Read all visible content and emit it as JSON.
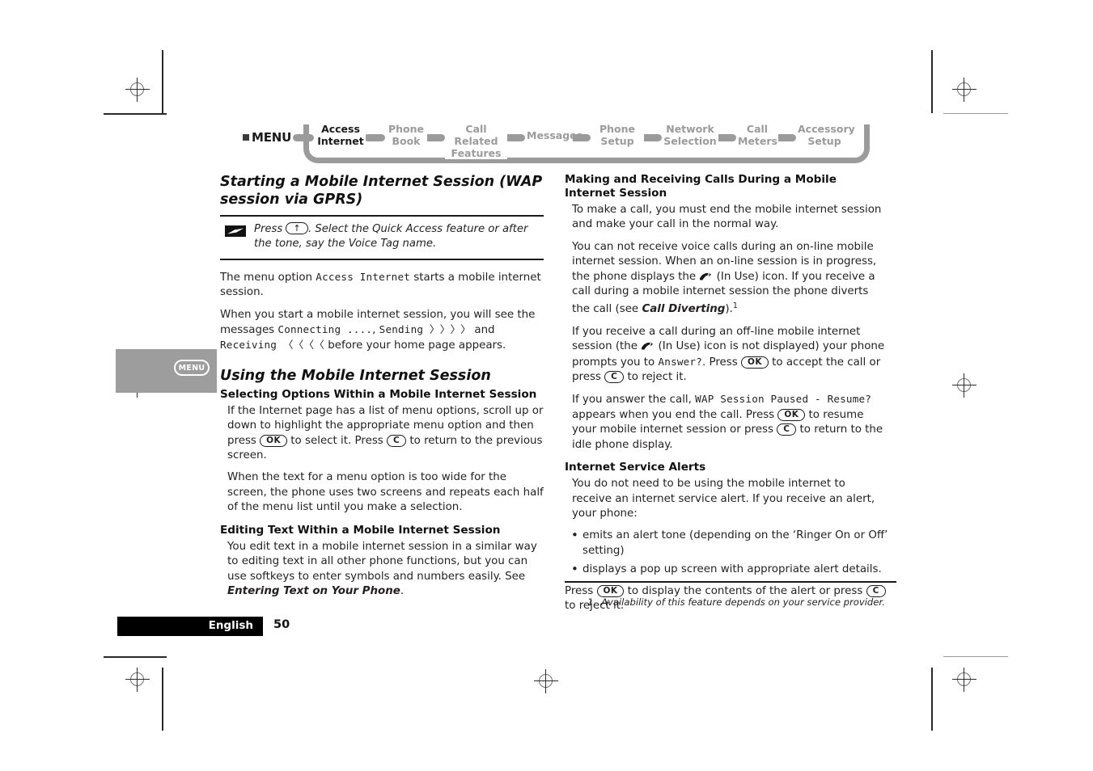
{
  "menu_map": {
    "root_label": "MENU",
    "crumbs": [
      {
        "line1": "Access",
        "line2": "Internet",
        "current": true
      },
      {
        "line1": "Phone",
        "line2": "Book",
        "current": false
      },
      {
        "line1": "Call Related",
        "line2": "Features",
        "current": false
      },
      {
        "line1": "Messages",
        "line2": "",
        "current": false
      },
      {
        "line1": "Phone",
        "line2": "Setup",
        "current": false
      },
      {
        "line1": "Network",
        "line2": "Selection",
        "current": false
      },
      {
        "line1": "Call",
        "line2": "Meters",
        "current": false
      },
      {
        "line1": "Accessory",
        "line2": "Setup",
        "current": false
      }
    ]
  },
  "side_tab": {
    "label": "MENU"
  },
  "left_column": {
    "heading": "Starting a Mobile Internet Session (WAP session via GPRS)",
    "note": {
      "text_1": "Press ",
      "key": "↑",
      "text_2": ". Select the Quick Access feature or after the tone, say the Voice Tag name."
    },
    "para_1_a": "The menu option ",
    "para_1_screen": "Access Internet",
    "para_1_b": " starts a mobile internet session.",
    "para_2_a": "When you start a mobile internet session, you will see the messages ",
    "para_2_s1": "Connecting ....",
    "para_2_b": ", ",
    "para_2_s2": "Sending 〉〉〉〉",
    "para_2_c": " and ",
    "para_2_s3": "Receiving 〈〈〈〈",
    "para_2_d": " before your home page appears.",
    "heading_2": "Using the Mobile Internet Session",
    "sub_1": "Selecting Options Within a Mobile Internet Session",
    "sub_1_para_a": "If the Internet page has a list of menu options, scroll up or down to highlight the appropriate menu option and then press ",
    "sub_1_key_ok": "OK",
    "sub_1_para_b": " to select it. Press ",
    "sub_1_key_c": "C",
    "sub_1_para_c": " to return to the previous screen.",
    "sub_1_para_2": "When the text for a menu option is too wide for the screen, the phone uses two screens and repeats each half of the menu list until you make a selection.",
    "sub_2": "Editing Text Within a Mobile Internet Session",
    "sub_2_para_a": "You edit text in a mobile internet session in a similar way to editing text in all other phone functions, but you can use softkeys to enter symbols and numbers easily. See ",
    "sub_2_bold": "Entering Text on Your Phone",
    "sub_2_para_b": "."
  },
  "right_column": {
    "sub_1": "Making and Receiving Calls During a Mobile Internet Session",
    "sub_1_para_1": "To make a call, you must end the mobile internet session and make your call in the normal way.",
    "sub_1_para_2_a": "You can not receive voice calls during an on-line mobile internet session. When an on-line session is in progress, the phone displays the ",
    "sub_1_para_2_b": " (In Use) icon. If you receive a call during a mobile internet session the phone diverts the call (see ",
    "sub_1_para_2_bold": "Call Diverting",
    "sub_1_para_2_c": ").",
    "sub_1_para_2_fn": "1",
    "sub_1_para_3_a": "If you receive a call during an off-line mobile internet session (the ",
    "sub_1_para_3_b": " (In Use) icon is not displayed) your phone prompts you to ",
    "sub_1_para_3_screen": "Answer?",
    "sub_1_para_3_c": ". Press ",
    "sub_1_key_ok": "OK",
    "sub_1_para_3_d": " to accept the call or press ",
    "sub_1_key_c": "C",
    "sub_1_para_3_e": " to reject it.",
    "sub_1_para_4_a": "If you answer the call, ",
    "sub_1_para_4_screen": "WAP Session Paused - Resume?",
    "sub_1_para_4_b": " appears when you end the call. Press ",
    "sub_1_para_4_key_ok": "OK",
    "sub_1_para_4_c": " to resume your mobile internet session or press ",
    "sub_1_para_4_key_c": "C",
    "sub_1_para_4_d": " to return to the idle phone display.",
    "sub_2": "Internet Service Alerts",
    "sub_2_para_1": "You do not need to be using the mobile internet to receive an internet service alert. If you receive an alert, your phone:",
    "bullets": [
      "emits an alert tone (depending on the ‘Ringer On or Off’ setting)",
      "displays a pop up screen with appropriate alert details."
    ],
    "sub_2_para_2_a": "Press ",
    "sub_2_key_ok": "OK",
    "sub_2_para_2_b": " to display the contents of the alert or press ",
    "sub_2_key_c": "C",
    "sub_2_para_2_c": " to reject it."
  },
  "footnote": {
    "number": "1.",
    "text": "Availability of this feature depends on your service provider."
  },
  "footer": {
    "language": "English",
    "page_number": "50"
  },
  "colors": {
    "text": "#231f20",
    "menu_gray": "#9b9b9b",
    "tab_gray": "#9d9d9d",
    "footer_bar": "#000000"
  }
}
